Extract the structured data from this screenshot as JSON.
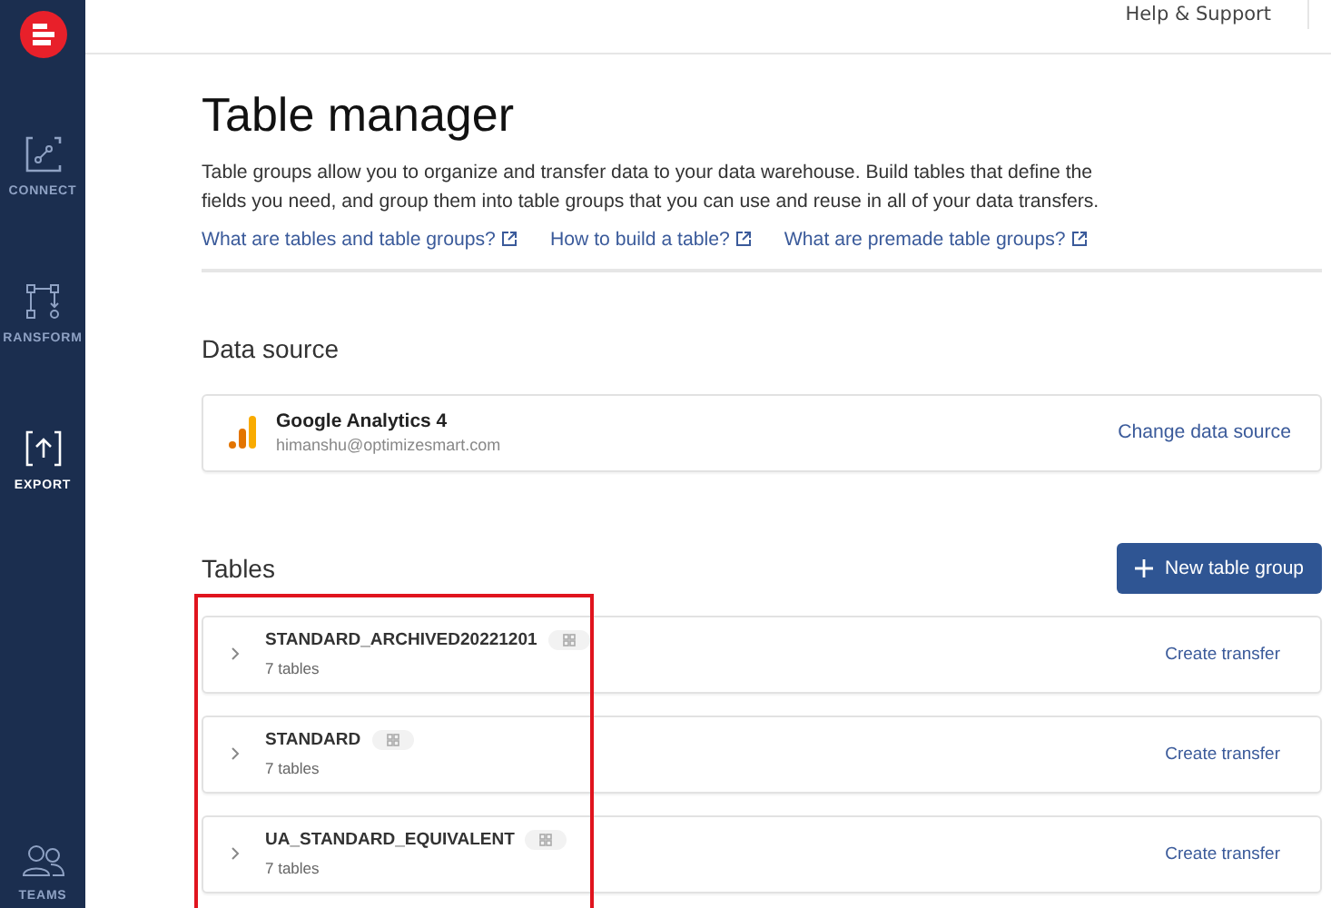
{
  "sidebar": {
    "items": [
      {
        "label": "CONNECT",
        "kind": "connect",
        "selected": false
      },
      {
        "label": "RANSFORM",
        "kind": "transform",
        "selected": false
      },
      {
        "label": "EXPORT",
        "kind": "export",
        "selected": true
      }
    ],
    "bottom_item": {
      "label": "TEAMS"
    }
  },
  "top_bar": {
    "help_link": "Help & Support"
  },
  "page": {
    "title": "Table manager",
    "description": "Table groups allow you to organize and transfer data to your data warehouse. Build tables that define the fields you need, and group them into table groups that you can use and reuse in all of your data transfers.",
    "links": [
      "What are tables and table groups?",
      "How to build a table?",
      "What are premade table groups?"
    ]
  },
  "data_source": {
    "heading": "Data source",
    "name": "Google Analytics 4",
    "account": "himanshu@optimizesmart.com",
    "action": "Change data source"
  },
  "tables": {
    "heading": "Tables",
    "new_button": "New table group",
    "groups": [
      {
        "name": "STANDARD_ARCHIVED20221201",
        "count": "7 tables",
        "action": "Create transfer"
      },
      {
        "name": "STANDARD",
        "count": "7 tables",
        "action": "Create transfer"
      },
      {
        "name": "UA_STANDARD_EQUIVALENT",
        "count": "7 tables",
        "action": "Create transfer"
      }
    ]
  }
}
